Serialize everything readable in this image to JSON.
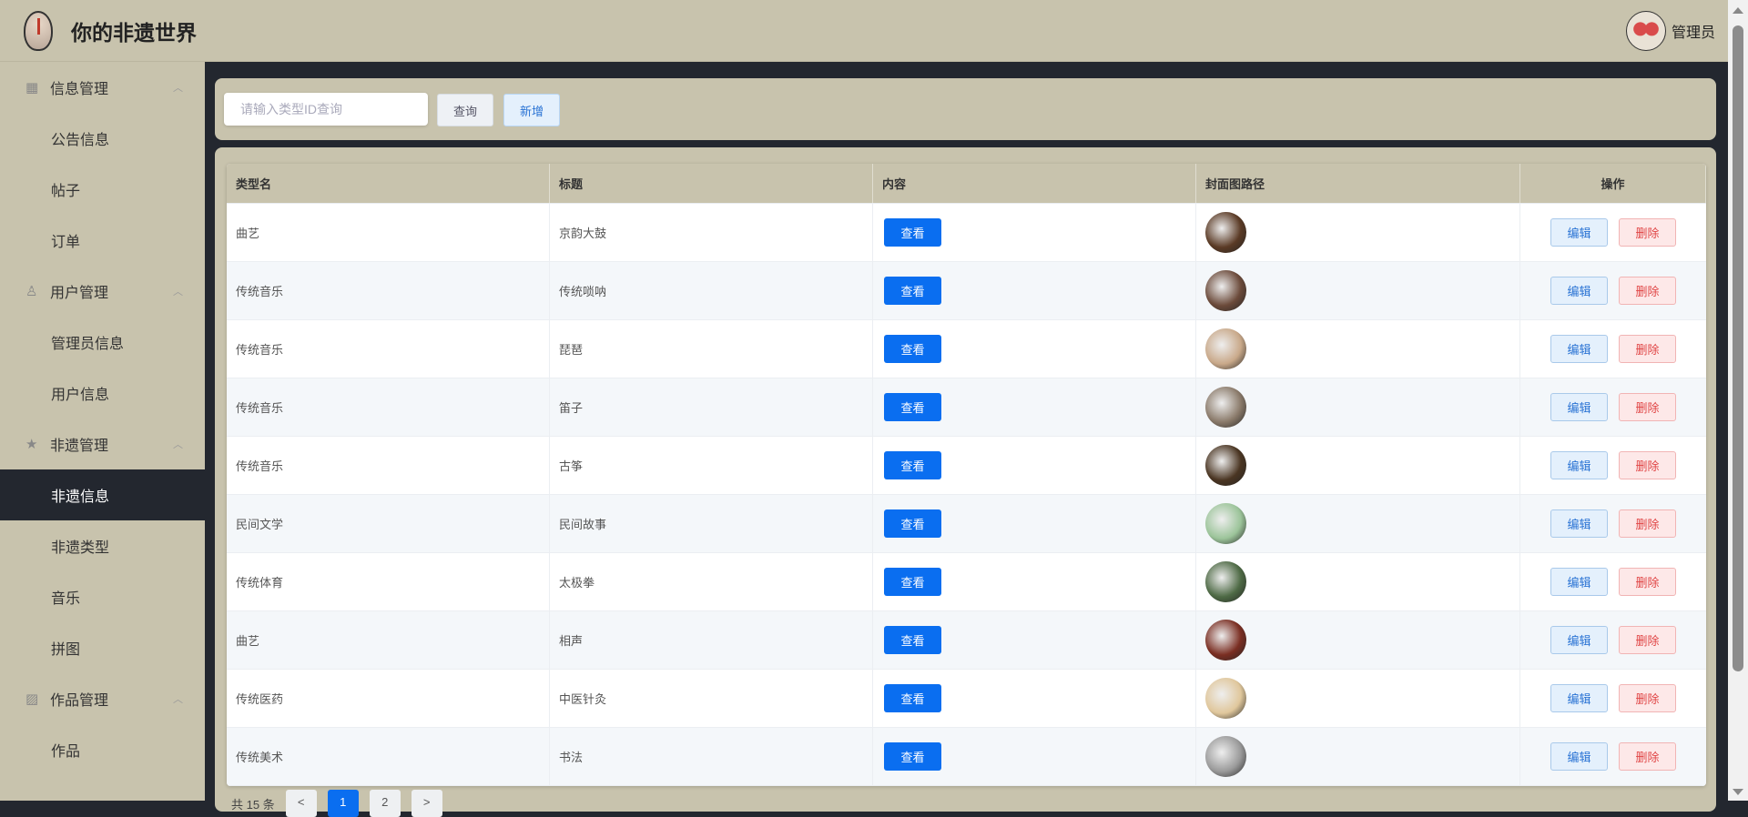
{
  "header": {
    "title": "你的非遗世界",
    "user": "管理员"
  },
  "sidebar": [
    {
      "type": "group",
      "label": "信息管理",
      "icon": "grid-icon"
    },
    {
      "type": "item",
      "label": "公告信息"
    },
    {
      "type": "item",
      "label": "帖子"
    },
    {
      "type": "item",
      "label": "订单"
    },
    {
      "type": "group",
      "label": "用户管理",
      "icon": "user-icon"
    },
    {
      "type": "item",
      "label": "管理员信息"
    },
    {
      "type": "item",
      "label": "用户信息"
    },
    {
      "type": "group",
      "label": "非遗管理",
      "icon": "star-icon"
    },
    {
      "type": "item",
      "label": "非遗信息",
      "active": true
    },
    {
      "type": "item",
      "label": "非遗类型"
    },
    {
      "type": "item",
      "label": "音乐"
    },
    {
      "type": "item",
      "label": "拼图"
    },
    {
      "type": "group",
      "label": "作品管理",
      "icon": "image-icon"
    },
    {
      "type": "item",
      "label": "作品"
    }
  ],
  "search": {
    "placeholder": "请输入类型ID查询",
    "query_label": "查询",
    "add_label": "新增"
  },
  "table": {
    "columns": [
      "类型名",
      "标题",
      "内容",
      "封面图路径",
      "操作"
    ],
    "view_label": "查看",
    "edit_label": "编辑",
    "delete_label": "删除",
    "rows": [
      {
        "type": "曲艺",
        "title": "京韵大鼓",
        "thumb": "#5a3a25"
      },
      {
        "type": "传统音乐",
        "title": "传统唢呐",
        "thumb": "#6b4a3a"
      },
      {
        "type": "传统音乐",
        "title": "琵琶",
        "thumb": "#c9a98a"
      },
      {
        "type": "传统音乐",
        "title": "笛子",
        "thumb": "#8a7a6a"
      },
      {
        "type": "传统音乐",
        "title": "古筝",
        "thumb": "#4a3522"
      },
      {
        "type": "民间文学",
        "title": "民间故事",
        "thumb": "#9cc49a"
      },
      {
        "type": "传统体育",
        "title": "太极拳",
        "thumb": "#4e6a45"
      },
      {
        "type": "曲艺",
        "title": "相声",
        "thumb": "#7a2e22"
      },
      {
        "type": "传统医药",
        "title": "中医针灸",
        "thumb": "#e0c79c"
      },
      {
        "type": "传统美术",
        "title": "书法",
        "thumb": "#9a9a9a"
      }
    ]
  },
  "pagination": {
    "total": "共 15 条",
    "prev": "<",
    "pages": [
      "1",
      "2"
    ],
    "current": "1",
    "next": ">"
  }
}
